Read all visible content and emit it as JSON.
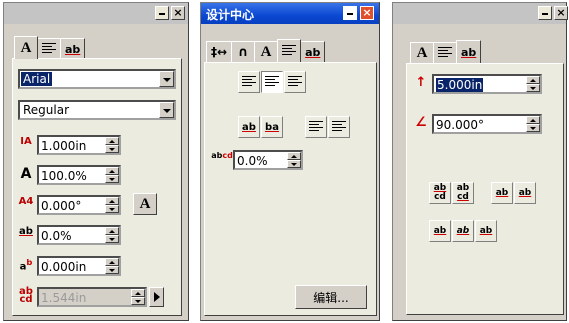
{
  "panel1": {
    "tabs": [
      {
        "label": "A"
      },
      {
        "label": "align"
      },
      {
        "label": "ab"
      }
    ],
    "font_name": "Arial",
    "font_style": "Regular",
    "fields": [
      {
        "icon": "IA",
        "value": "1.000in"
      },
      {
        "icon": "A",
        "value": "100.0%"
      },
      {
        "icon": "A4",
        "value": "0.000°"
      },
      {
        "icon": "ab",
        "value": "0.0%"
      },
      {
        "icon": "ab",
        "value": "0.000in"
      },
      {
        "icon": "abcd",
        "value": "1.544in"
      }
    ],
    "side_button": "A"
  },
  "panel2": {
    "title": "设计中心",
    "tabs": [
      {
        "label": "tracking"
      },
      {
        "label": "kerning"
      },
      {
        "label": "A"
      },
      {
        "label": "align"
      },
      {
        "label": "ab"
      }
    ],
    "field_value": "0.0%",
    "edit_button": "编辑..."
  },
  "panel3": {
    "tabs": [
      {
        "label": "A"
      },
      {
        "label": "align"
      },
      {
        "label": "ab"
      }
    ],
    "height_value": "5.000in",
    "angle_value": "90.000°",
    "tool_labels": [
      "ab cd",
      "ab cd",
      "ab",
      "ab",
      "ab",
      "ab",
      "ab"
    ]
  },
  "colors": {
    "selection": "#0a246a",
    "title_active": "#0a48d2",
    "face": "#d4d0c8"
  }
}
